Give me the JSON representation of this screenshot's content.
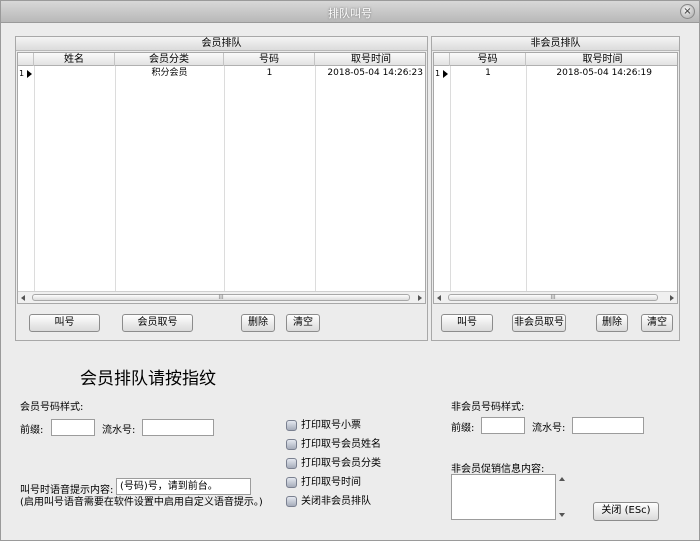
{
  "window": {
    "title": "排队叫号",
    "close_glyph": "×"
  },
  "member_queue": {
    "title": "会员排队",
    "columns": [
      "姓名",
      "会员分类",
      "号码",
      "取号时间"
    ],
    "rows": [
      {
        "index": "1",
        "name": "",
        "category": "积分会员",
        "number": "1",
        "time": "2018-05-04 14:26:23"
      }
    ],
    "scroll_grip": "III",
    "buttons": {
      "call": "叫号",
      "take_number": "会员取号",
      "delete": "删除",
      "clear": "清空"
    }
  },
  "nonmember_queue": {
    "title": "非会员排队",
    "columns": [
      "号码",
      "取号时间"
    ],
    "rows": [
      {
        "index": "1",
        "number": "1",
        "time": "2018-05-04 14:26:19"
      }
    ],
    "scroll_grip": "III",
    "buttons": {
      "call": "叫号",
      "take_number": "非会员取号",
      "delete": "删除",
      "clear": "清空"
    }
  },
  "fingerprint_prompt": "会员排队请按指纹",
  "member_format": {
    "title": "会员号码样式:",
    "prefix_label": "前缀:",
    "prefix_value": "",
    "serial_label": "流水号:",
    "serial_value": ""
  },
  "voice": {
    "label": "叫号时语音提示内容:",
    "value": "(号码)号，请到前台。",
    "note": "(启用叫号语音需要在软件设置中启用自定义语音提示。)"
  },
  "options": [
    {
      "label": "打印取号小票",
      "checked": false
    },
    {
      "label": "打印取号会员姓名",
      "checked": false
    },
    {
      "label": "打印取号会员分类",
      "checked": false
    },
    {
      "label": "打印取号时间",
      "checked": false
    },
    {
      "label": "关闭非会员排队",
      "checked": false
    }
  ],
  "nonmember_format": {
    "title": "非会员号码样式:",
    "prefix_label": "前缀:",
    "prefix_value": "",
    "serial_label": "流水号:",
    "serial_value": ""
  },
  "promo": {
    "label": "非会员促销信息内容:",
    "value": ""
  },
  "close_button": "关闭 (ESc)"
}
